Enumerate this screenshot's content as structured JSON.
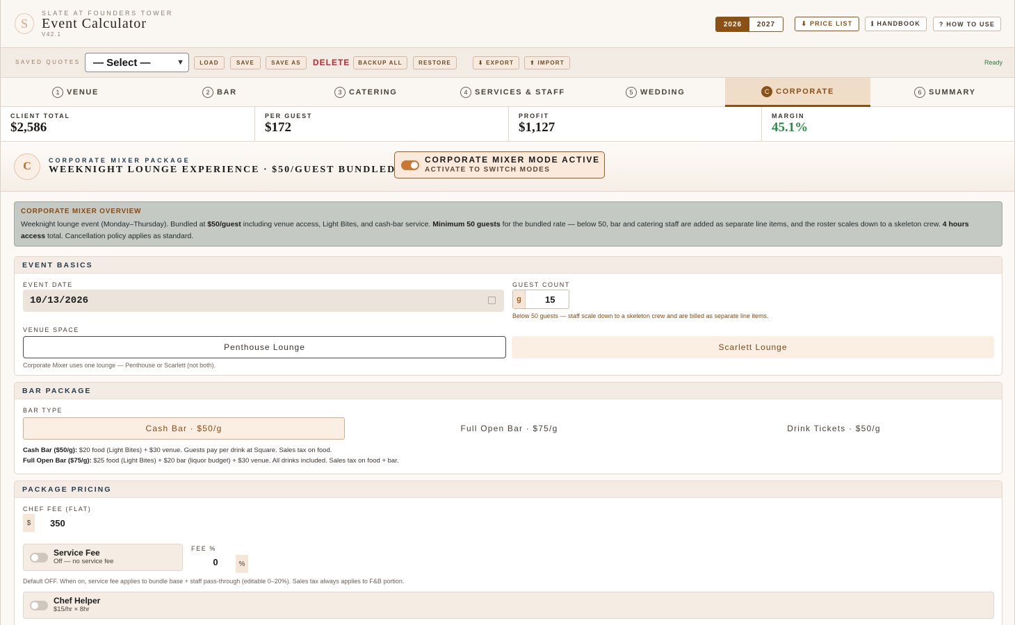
{
  "header": {
    "logo_letter": "S",
    "brand_sub": "SLATE AT FOUNDERS TOWER",
    "title": "Event Calculator",
    "version": "V42.1",
    "years": [
      "2026",
      "2027"
    ],
    "price_list": "⬇ PRICE LIST",
    "handbook": "ℹ HANDBOOK",
    "how_to": "? HOW TO USE"
  },
  "toolbar": {
    "label": "SAVED QUOTES",
    "select_value": "— Select —",
    "load": "LOAD",
    "save": "SAVE",
    "save_as": "SAVE AS",
    "delete": "DELETE",
    "backup_all": "BACKUP ALL",
    "restore": "RESTORE",
    "export": "⬇ EXPORT",
    "import": "⬆ IMPORT",
    "status": "Ready"
  },
  "tabs": [
    {
      "num": "1",
      "label": "VENUE"
    },
    {
      "num": "2",
      "label": "BAR"
    },
    {
      "num": "3",
      "label": "CATERING"
    },
    {
      "num": "4",
      "label": "SERVICES & STAFF"
    },
    {
      "num": "5",
      "label": "WEDDING"
    },
    {
      "num": "C",
      "label": "CORPORATE"
    },
    {
      "num": "6",
      "label": "SUMMARY"
    }
  ],
  "kpis": {
    "client_total": {
      "label": "CLIENT TOTAL",
      "value": "$2,586"
    },
    "per_guest": {
      "label": "PER GUEST",
      "value": "$172"
    },
    "profit": {
      "label": "PROFIT",
      "value": "$1,127"
    },
    "margin": {
      "label": "MARGIN",
      "value": "45.1%"
    }
  },
  "banner": {
    "badge": "C",
    "eyebrow": "CORPORATE MIXER PACKAGE",
    "title": "WEEKNIGHT LOUNGE EXPERIENCE · $50/GUEST BUNDLED",
    "mode_title": "CORPORATE MIXER MODE ACTIVE",
    "mode_sub": "ACTIVATE TO SWITCH MODES"
  },
  "overview": {
    "title": "CORPORATE MIXER OVERVIEW",
    "t1": "Weeknight lounge event (Monday–Thursday). Bundled at ",
    "b1": "$50/guest",
    "t2": " including venue access, Light Bites, and cash-bar service. ",
    "b2": "Minimum 50 guests",
    "t3": " for the bundled rate — below 50, bar and catering staff are added as separate line items, and the roster scales down to a skeleton crew. ",
    "b3": "4 hours access",
    "t4": " total. Cancellation policy applies as standard."
  },
  "event_basics": {
    "heading": "EVENT BASICS",
    "date_label": "EVENT DATE",
    "date_value": "10/13/2026",
    "guest_label": "GUEST COUNT",
    "guest_prefix": "g",
    "guest_value": "15",
    "guest_warning": "Below 50 guests — staff scale down to a skeleton crew and are billed as separate line items.",
    "venue_label": "VENUE SPACE",
    "venue_a": "Penthouse Lounge",
    "venue_b": "Scarlett Lounge",
    "venue_hint": "Corporate Mixer uses one lounge — Penthouse or Scarlett (not both)."
  },
  "bar_package": {
    "heading": "BAR PACKAGE",
    "type_label": "BAR TYPE",
    "options": [
      "Cash Bar · $50/g",
      "Full Open Bar · $75/g",
      "Drink Tickets · $50/g"
    ],
    "note1_b": "Cash Bar ($50/g):",
    "note1": " $20 food (Light Bites) + $30 venue. Guests pay per drink at Square. Sales tax on food.",
    "note2_b": "Full Open Bar ($75/g):",
    "note2": " $25 food (Light Bites) + $20 bar (liquor budget) + $30 venue. All drinks included. Sales tax on food + bar."
  },
  "package_pricing": {
    "heading": "PACKAGE PRICING",
    "chef_label": "CHEF FEE (FLAT)",
    "chef_prefix": "$",
    "chef_value": "350",
    "service_title": "Service Fee",
    "service_sub": "Off — no service fee",
    "fee_label": "FEE %",
    "fee_value": "0",
    "fee_suffix": "%",
    "fee_hint": "Default OFF. When on, service fee applies to bundle base + staff pass-through (editable 0–20%). Sales tax always applies to F&B portion.",
    "helper_title": "Chef Helper",
    "helper_sub": "$15/hr × 8hr"
  }
}
